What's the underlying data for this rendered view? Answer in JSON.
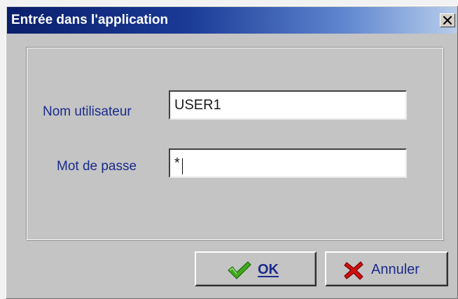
{
  "window": {
    "title": "Entrée dans l'application"
  },
  "form": {
    "username_label": "Nom utilisateur",
    "username_value": "USER1",
    "password_label": "Mot de passe",
    "password_value": "*"
  },
  "buttons": {
    "ok_label": "OK",
    "cancel_label": "Annuler"
  },
  "icons": {
    "close": "close-icon",
    "ok": "checkmark-icon",
    "cancel": "cross-icon"
  },
  "colors": {
    "titlebar_start": "#0a1f6b",
    "titlebar_end": "#b8cdeb",
    "label_text": "#1a2b8c",
    "dialog_bg": "#c4c4c4",
    "check_green": "#3fa81e",
    "cross_red": "#d01010"
  }
}
